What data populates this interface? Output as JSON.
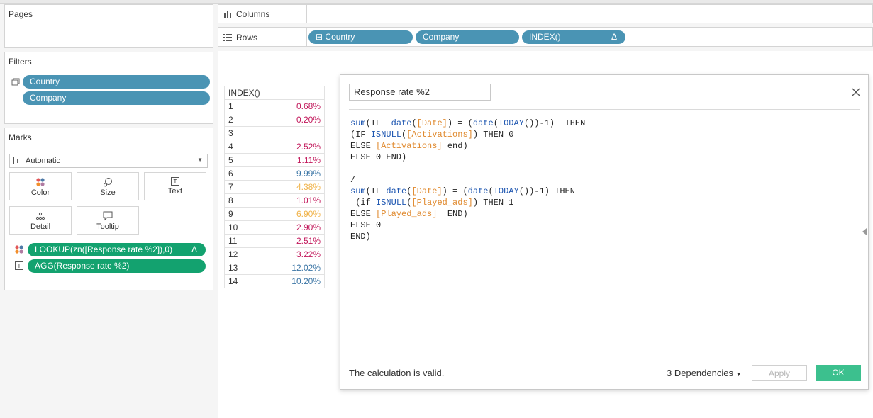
{
  "pages_panel": {
    "title": "Pages"
  },
  "filters_panel": {
    "title": "Filters",
    "filters": [
      {
        "label": "Country"
      },
      {
        "label": "Company"
      }
    ]
  },
  "marks_panel": {
    "title": "Marks",
    "mark_type": "Automatic",
    "buttons": [
      {
        "label": "Color",
        "icon": "color-dots-icon"
      },
      {
        "label": "Size",
        "icon": "size-icon"
      },
      {
        "label": "Text",
        "icon": "text-icon"
      },
      {
        "label": "Detail",
        "icon": "detail-icon"
      },
      {
        "label": "Tooltip",
        "icon": "tooltip-icon"
      }
    ],
    "fields": [
      {
        "label": "LOOKUP(zn([Response rate %2]),0)",
        "delta": "Δ",
        "icon": "color-dots-icon"
      },
      {
        "label": "AGG(Response rate %2)",
        "icon": "text-icon"
      }
    ]
  },
  "columns_shelf": {
    "label": "Columns"
  },
  "rows_shelf": {
    "label": "Rows",
    "pills": [
      {
        "label": "Country",
        "prefix": "⊟"
      },
      {
        "label": "Company"
      },
      {
        "label": "INDEX()",
        "delta": "Δ"
      }
    ]
  },
  "view_table": {
    "header": "INDEX()",
    "rows": [
      {
        "index": "1",
        "value": "0.68%",
        "color": "#c2185b"
      },
      {
        "index": "2",
        "value": "0.20%",
        "color": "#c2185b"
      },
      {
        "index": "3",
        "value": "",
        "color": "#333333"
      },
      {
        "index": "4",
        "value": "2.52%",
        "color": "#c2185b"
      },
      {
        "index": "5",
        "value": "1.11%",
        "color": "#c2185b"
      },
      {
        "index": "6",
        "value": "9.99%",
        "color": "#3b75a5"
      },
      {
        "index": "7",
        "value": "4.38%",
        "color": "#f0b248"
      },
      {
        "index": "8",
        "value": "1.01%",
        "color": "#c2185b"
      },
      {
        "index": "9",
        "value": "6.90%",
        "color": "#f0b248"
      },
      {
        "index": "10",
        "value": "2.90%",
        "color": "#c2185b"
      },
      {
        "index": "11",
        "value": "2.51%",
        "color": "#c2185b"
      },
      {
        "index": "12",
        "value": "3.22%",
        "color": "#c2185b"
      },
      {
        "index": "13",
        "value": "12.02%",
        "color": "#3b75a5"
      },
      {
        "index": "14",
        "value": "10.20%",
        "color": "#3b75a5"
      }
    ]
  },
  "calc_dialog": {
    "name": "Response rate %2",
    "close_icon": "close-icon",
    "code_lines": [
      [
        {
          "t": "sum",
          "c": "kw"
        },
        {
          "t": "(IF  "
        },
        {
          "t": "date",
          "c": "kw"
        },
        {
          "t": "("
        },
        {
          "t": "[Date]",
          "c": "fld"
        },
        {
          "t": ") = ("
        },
        {
          "t": "date",
          "c": "kw"
        },
        {
          "t": "("
        },
        {
          "t": "TODAY",
          "c": "kw"
        },
        {
          "t": "())-1)  THEN"
        }
      ],
      [
        {
          "t": "(IF "
        },
        {
          "t": "ISNULL",
          "c": "kw"
        },
        {
          "t": "("
        },
        {
          "t": "[Activations]",
          "c": "fld"
        },
        {
          "t": ") THEN 0"
        }
      ],
      [
        {
          "t": "ELSE "
        },
        {
          "t": "[Activations]",
          "c": "fld"
        },
        {
          "t": " end)"
        }
      ],
      [
        {
          "t": "ELSE 0 END)"
        }
      ],
      [],
      [
        {
          "t": "/"
        }
      ],
      [
        {
          "t": "sum",
          "c": "kw"
        },
        {
          "t": "(IF "
        },
        {
          "t": "date",
          "c": "kw"
        },
        {
          "t": "("
        },
        {
          "t": "[Date]",
          "c": "fld"
        },
        {
          "t": ") = ("
        },
        {
          "t": "date",
          "c": "kw"
        },
        {
          "t": "("
        },
        {
          "t": "TODAY",
          "c": "kw"
        },
        {
          "t": "())-1) THEN"
        }
      ],
      [
        {
          "t": " (if "
        },
        {
          "t": "ISNULL",
          "c": "kw"
        },
        {
          "t": "("
        },
        {
          "t": "[Played_ads]",
          "c": "fld"
        },
        {
          "t": ") THEN 1"
        }
      ],
      [
        {
          "t": "ELSE "
        },
        {
          "t": "[Played_ads]",
          "c": "fld"
        },
        {
          "t": "  END)"
        }
      ],
      [
        {
          "t": "ELSE 0"
        }
      ],
      [
        {
          "t": "END)"
        }
      ]
    ],
    "status": "The calculation is valid.",
    "dependencies": "3 Dependencies",
    "apply_label": "Apply",
    "ok_label": "OK"
  }
}
